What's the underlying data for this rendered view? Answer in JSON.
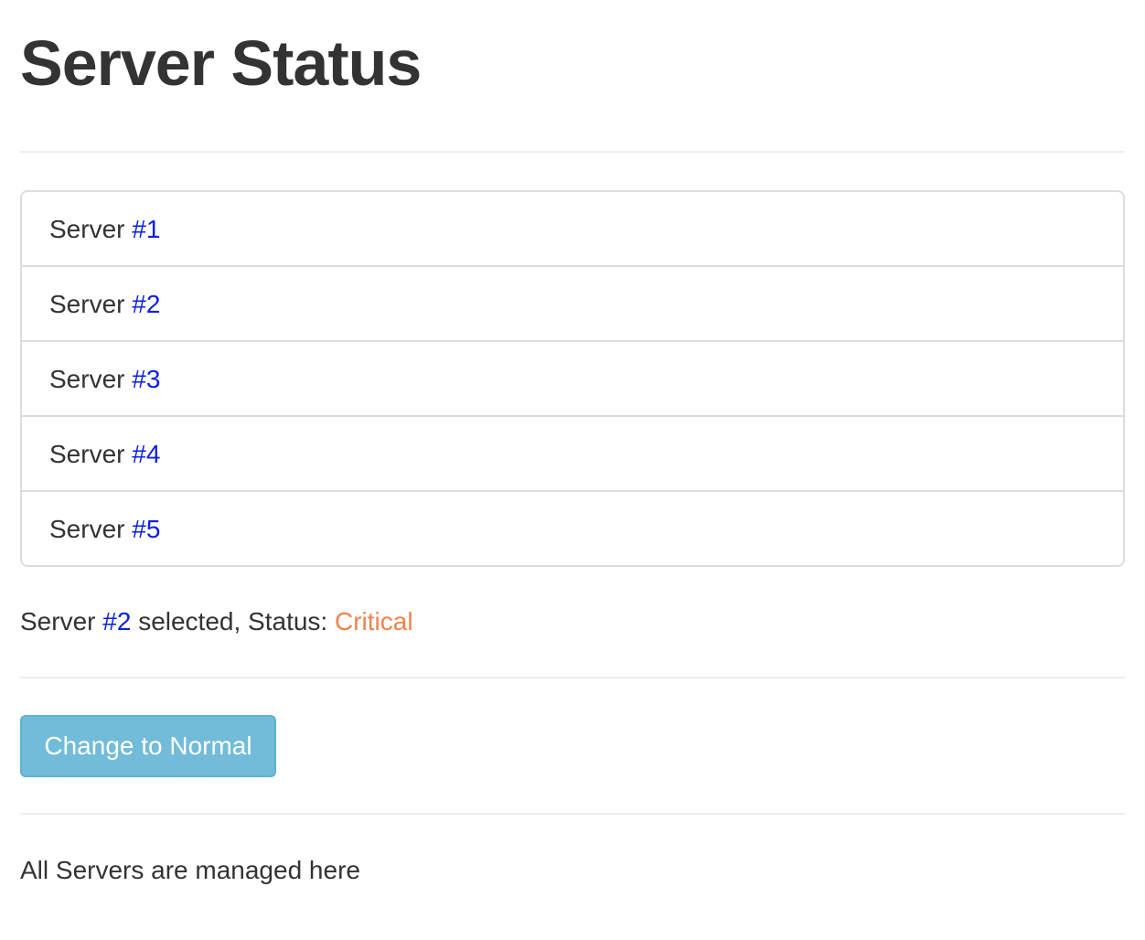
{
  "page": {
    "title": "Server Status"
  },
  "servers": [
    {
      "label": "Server",
      "number": "#1"
    },
    {
      "label": "Server",
      "number": "#2"
    },
    {
      "label": "Server",
      "number": "#3"
    },
    {
      "label": "Server",
      "number": "#4"
    },
    {
      "label": "Server",
      "number": "#5"
    }
  ],
  "selection": {
    "prefix": "Server",
    "number": "#2",
    "middle": "selected, Status:",
    "status": "Critical"
  },
  "actions": {
    "toggle_label": "Change to Normal"
  },
  "footer": {
    "text": "All Servers are managed here"
  },
  "colors": {
    "server_number": "#0a1fe6",
    "status_critical": "#f0824b",
    "button_bg": "#72bcd9",
    "text": "#333333"
  }
}
